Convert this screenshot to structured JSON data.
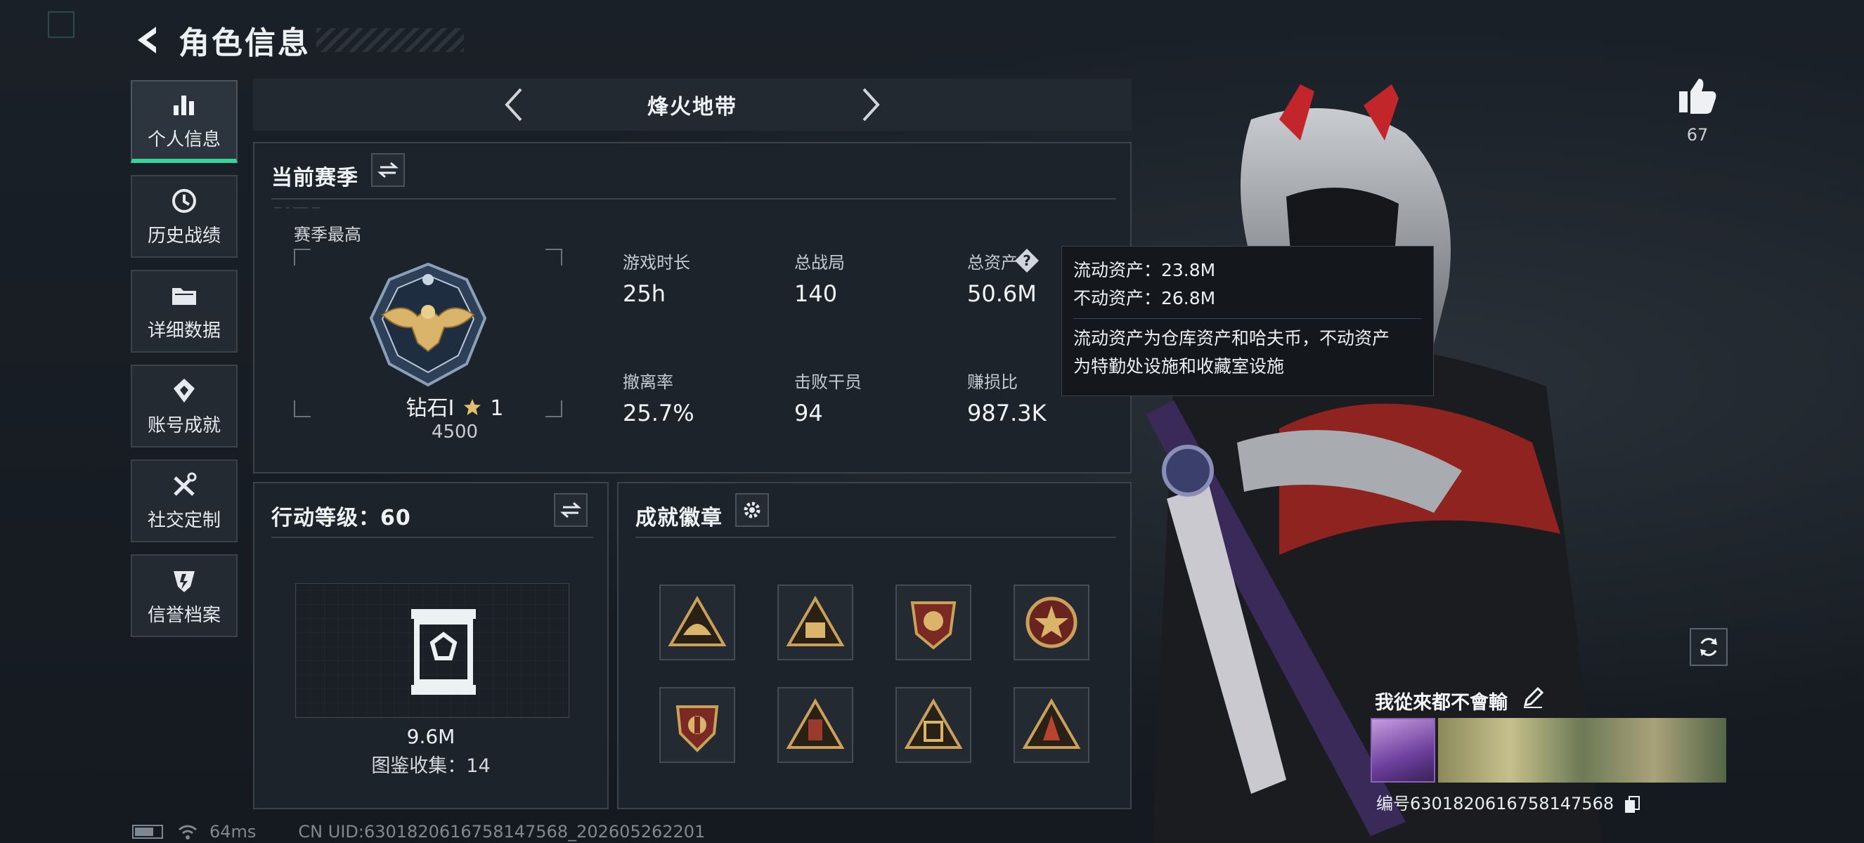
{
  "header": {
    "title": "角色信息"
  },
  "sidebar": {
    "items": [
      {
        "label": "个人信息",
        "icon": "bar-chart-icon",
        "active": true
      },
      {
        "label": "历史战绩",
        "icon": "history-icon"
      },
      {
        "label": "详细数据",
        "icon": "folder-icon"
      },
      {
        "label": "账号成就",
        "icon": "medal-icon"
      },
      {
        "label": "社交定制",
        "icon": "tools-icon"
      },
      {
        "label": "信誉档案",
        "icon": "shield-icon"
      }
    ]
  },
  "mode": {
    "name": "烽火地带"
  },
  "season": {
    "title": "当前赛季",
    "best_label": "赛季最高",
    "rank_name": "钻石I",
    "rank_stars": "1",
    "rank_score": "4500",
    "stats": [
      {
        "label": "游戏时长",
        "value": "25h"
      },
      {
        "label": "总战局",
        "value": "140"
      },
      {
        "label": "总资产",
        "value": "50.6M"
      },
      {
        "label": "撤离率",
        "value": "25.7%"
      },
      {
        "label": "击败干员",
        "value": "94"
      },
      {
        "label": "赚损比",
        "value": "987.3K"
      }
    ]
  },
  "tooltip": {
    "line1": "流动资产：23.8M",
    "line2": "不动资产：26.8M",
    "desc1": "流动资产为仓库资产和哈夫币，不动资产",
    "desc2": "为特勤处设施和收藏室设施"
  },
  "level": {
    "title": "行动等级：60",
    "collection_value": "9.6M",
    "collection_count": "图鉴收集：14"
  },
  "badges": {
    "title": "成就徽章"
  },
  "profile": {
    "likes": "67",
    "player_name": "我從來都不會輸",
    "uid_text": "编号6301820616758147568"
  },
  "status_bar": {
    "ping": "64ms",
    "uid": "CN UID:6301820616758147568_202605262201"
  },
  "colors": {
    "accent": "#38d39b",
    "panel": "#1d232a",
    "gold": "#c9a15a"
  }
}
